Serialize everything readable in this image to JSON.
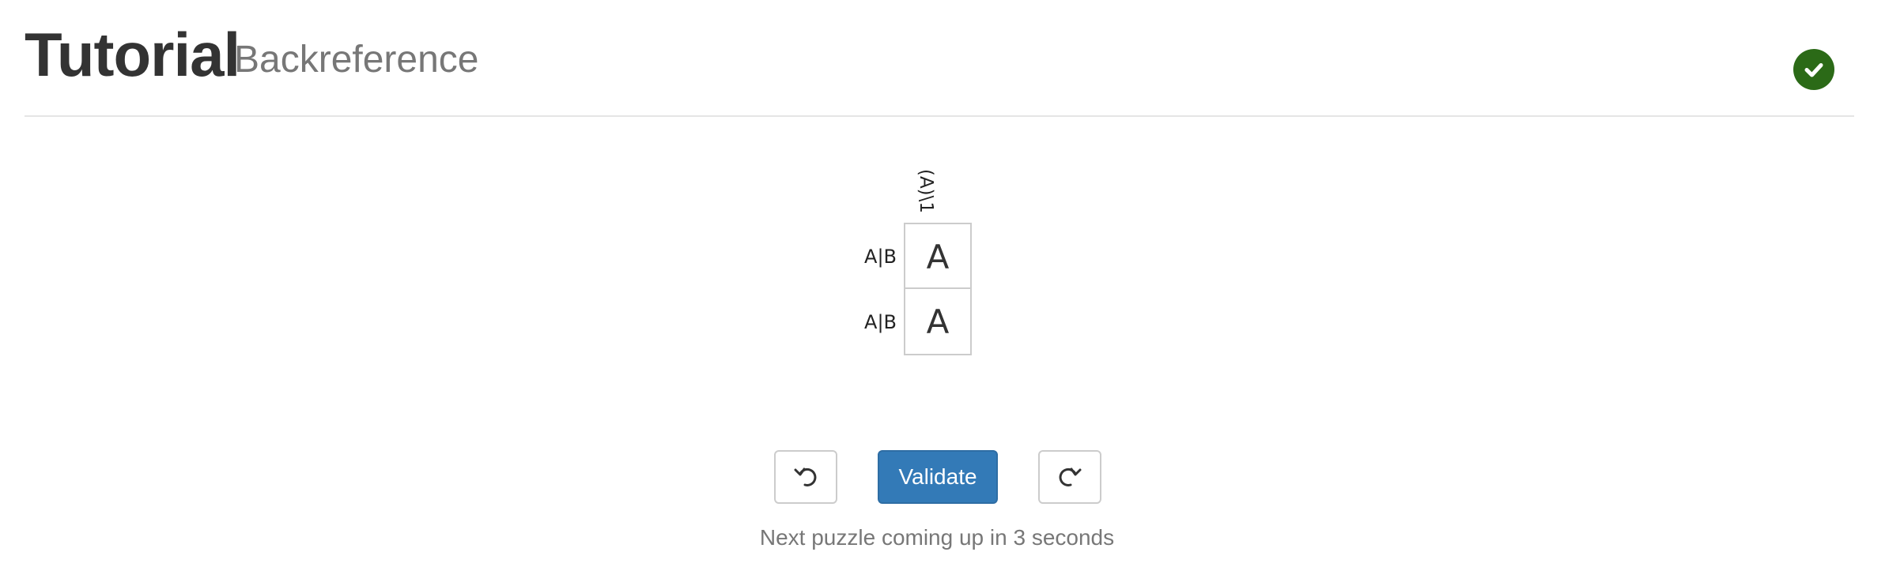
{
  "header": {
    "title": "Tutorial",
    "subtitle": "Backreference",
    "status_icon": "check-circle-icon",
    "status_color": "#2b6a17"
  },
  "puzzle": {
    "column_clues": [
      "(A)\\1"
    ],
    "row_clues": [
      "A|B",
      "A|B"
    ],
    "grid": [
      [
        "A"
      ],
      [
        "A"
      ]
    ]
  },
  "controls": {
    "undo_icon": "undo-icon",
    "validate_label": "Validate",
    "redo_icon": "redo-icon",
    "accent_color": "#337ab7"
  },
  "status": {
    "message": "Next puzzle coming up in 3 seconds"
  }
}
